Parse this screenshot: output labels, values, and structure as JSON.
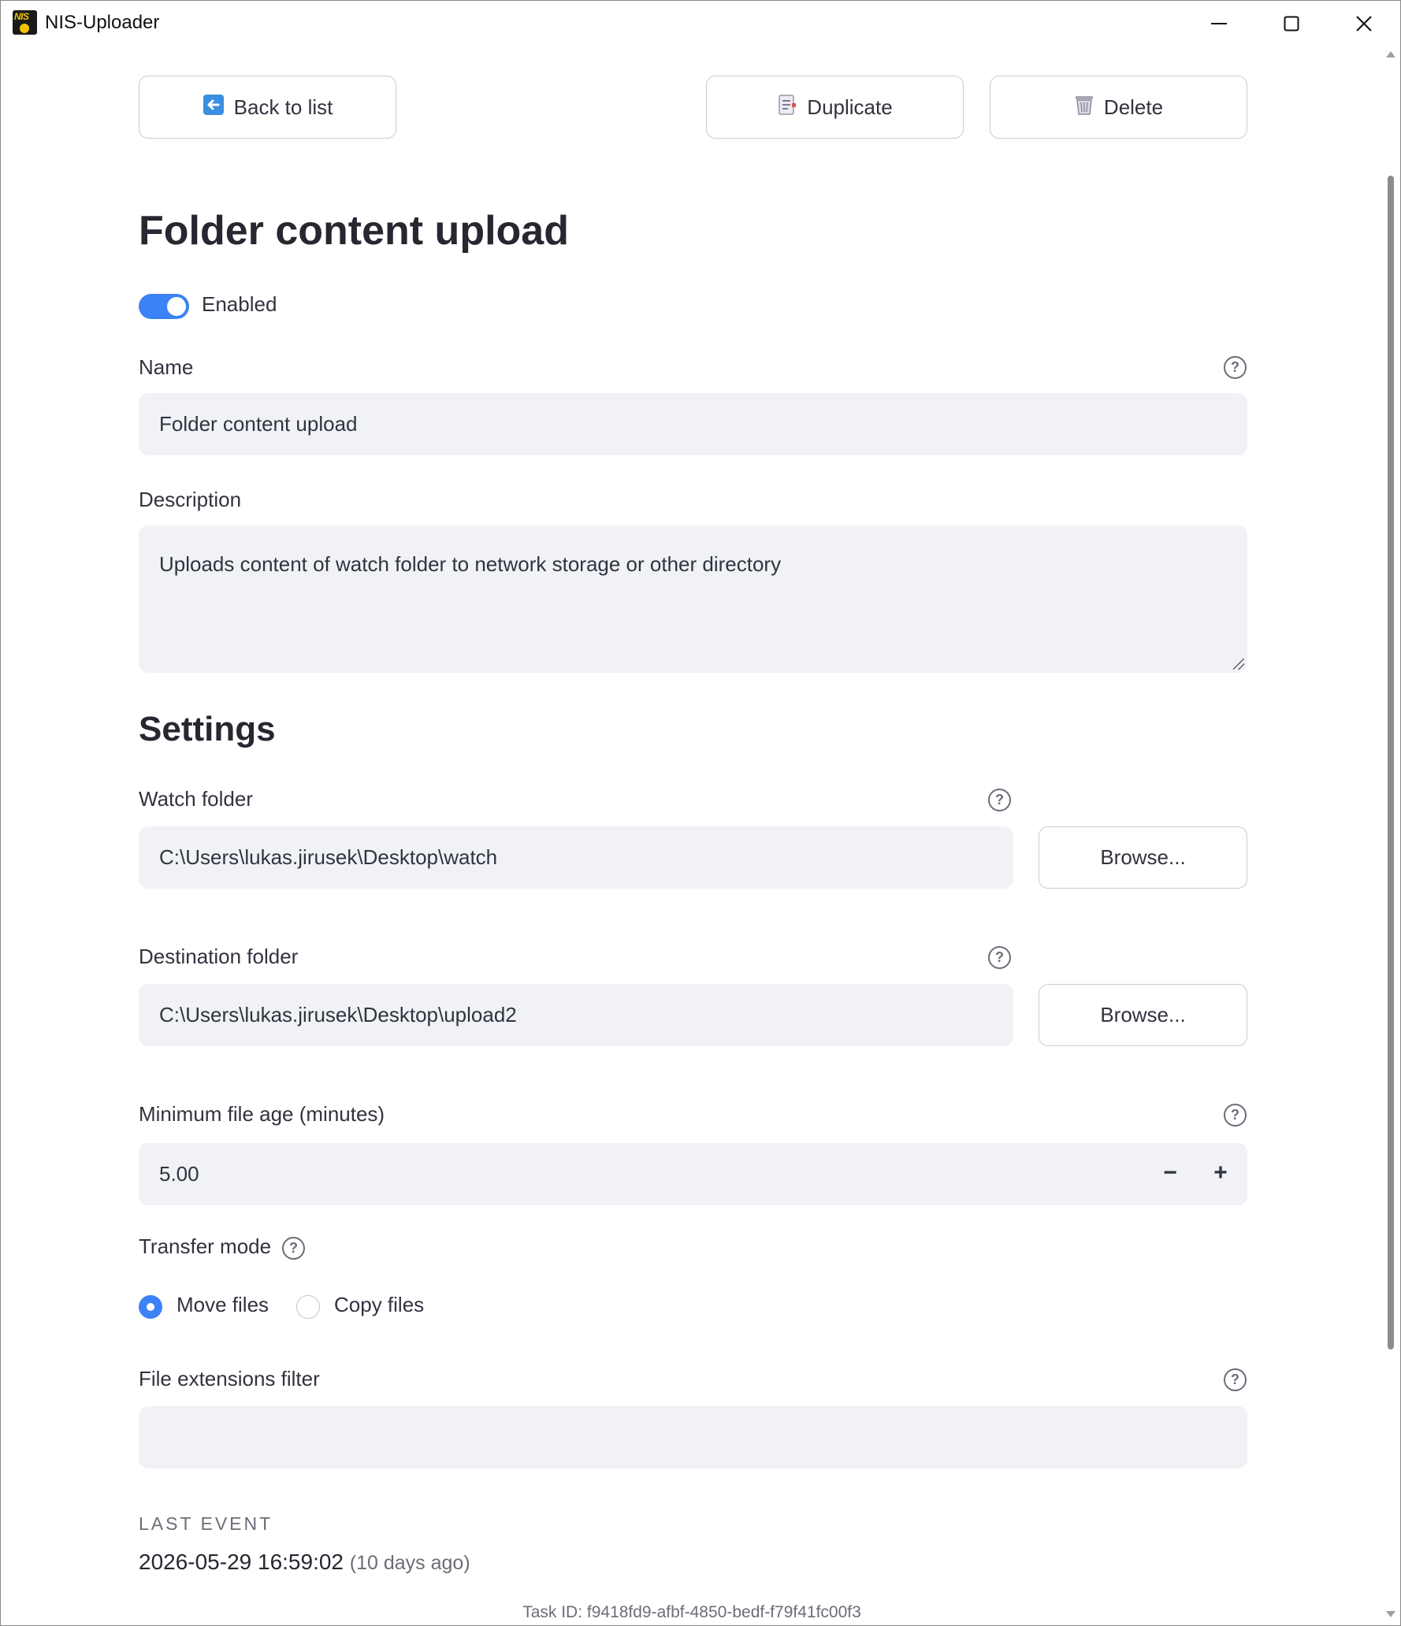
{
  "window": {
    "title": "NIS-Uploader",
    "logo_text": "NIS"
  },
  "toolbar": {
    "back_label": "Back to list",
    "duplicate_label": "Duplicate",
    "delete_label": "Delete"
  },
  "task": {
    "heading": "Folder content upload",
    "enabled_label": "Enabled",
    "enabled": true
  },
  "form": {
    "name": {
      "label": "Name",
      "value": "Folder content upload"
    },
    "description": {
      "label": "Description",
      "value": "Uploads content of watch folder to network storage or other directory"
    }
  },
  "settings": {
    "heading": "Settings",
    "watch_folder": {
      "label": "Watch folder",
      "value": "C:\\Users\\lukas.jirusek\\Desktop\\watch",
      "browse_label": "Browse..."
    },
    "destination_folder": {
      "label": "Destination folder",
      "value": "C:\\Users\\lukas.jirusek\\Desktop\\upload2",
      "browse_label": "Browse..."
    },
    "min_file_age": {
      "label": "Minimum file age (minutes)",
      "value": "5.00",
      "decrement": "−",
      "increment": "+"
    },
    "transfer_mode": {
      "label": "Transfer mode",
      "options": [
        "Move files",
        "Copy files"
      ],
      "selected": "Move files"
    },
    "file_extensions_filter": {
      "label": "File extensions filter",
      "value": ""
    }
  },
  "last_event": {
    "label": "LAST EVENT",
    "timestamp": "2026-05-29 16:59:02",
    "relative": "(10 days ago)"
  },
  "footer": {
    "task_id": "Task ID: f9418fd9-afbf-4850-bedf-f79f41fc00f3"
  },
  "colors": {
    "accent": "#3b82f6",
    "input_bg": "#f0f2f6",
    "text": "#31333f",
    "muted": "#6b6d78"
  },
  "icons": {
    "help": "?",
    "back": "back-arrow-icon",
    "duplicate": "duplicate-document-icon",
    "delete": "trash-icon"
  }
}
